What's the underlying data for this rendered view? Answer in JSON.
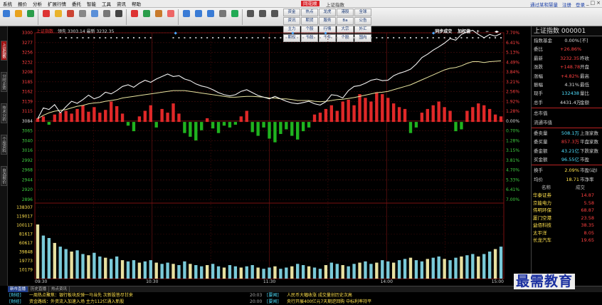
{
  "menu": [
    "系统",
    "报价",
    "分析",
    "扩展行情",
    "委托",
    "智能",
    "工具",
    "资讯",
    "帮助"
  ],
  "app_logo": "同花顺",
  "window_title": "上证指数",
  "menu_right": [
    "通过某和慧量",
    "注册",
    "登录"
  ],
  "window_controls": [
    "_",
    "□",
    "×"
  ],
  "toolbar": [
    {
      "label": "",
      "icon": "grid-icon",
      "color": "#3a7bd5"
    },
    {
      "label": "",
      "icon": "back-icon",
      "color": "#e8a21c"
    },
    {
      "label": "",
      "icon": "forward-icon",
      "color": "#2a9d4a"
    },
    {
      "label": "",
      "icon": "refresh-icon",
      "color": "#d33"
    },
    {
      "label": "",
      "icon": "star-icon",
      "color": "#e9b32c"
    },
    {
      "label": "",
      "icon": "flag-icon",
      "color": "#c43"
    },
    {
      "label": "",
      "icon": "bell-icon",
      "color": "#888"
    },
    {
      "label": "",
      "icon": "doc-icon",
      "color": "#5a8fd8"
    },
    {
      "label": "",
      "icon": "calc-icon",
      "color": "#777"
    },
    {
      "label": "",
      "icon": "news-icon",
      "color": "#444"
    },
    {
      "label": "",
      "icon": "buy-icon",
      "color": "#d33"
    },
    {
      "label": "",
      "icon": "sell-icon",
      "color": "#2a9d4a"
    },
    {
      "label": "",
      "icon": "lock-icon",
      "color": "#c87a2c"
    },
    {
      "label": "",
      "icon": "cash-icon",
      "color": "#e66"
    },
    {
      "label": "",
      "icon": "chart-icon",
      "color": "#3a7bd5"
    },
    {
      "label": "",
      "icon": "chart2-icon",
      "color": "#3a7bd5"
    },
    {
      "label": "",
      "icon": "kline-icon",
      "color": "#3a7bd5"
    },
    {
      "label": "",
      "icon": "pen-icon",
      "color": "#777"
    },
    {
      "label": "",
      "icon": "f10-icon",
      "color": "#2a5"
    },
    {
      "label": "",
      "icon": "zoom-icon",
      "color": "#555"
    },
    {
      "label": "",
      "icon": "info-icon",
      "color": "#555"
    },
    {
      "label": "",
      "icon": "list-icon",
      "color": "#555"
    }
  ],
  "toolbar_group": [
    "资金",
    "热点",
    "龙虎",
    "港股",
    "全球",
    "资讯",
    "期货",
    "服务",
    "Ba",
    "公告",
    "主力",
    "个股",
    "行情",
    "大宗",
    "外汇",
    "期权",
    "千股",
    "千牛",
    "个股",
    "国内",
    "指数",
    "财务",
    "资金",
    "价值",
    "研报",
    "行情",
    "综合",
    "经济"
  ],
  "left_tabs": [
    {
      "label": "上证指数",
      "active": true
    },
    {
      "label": "分时走势",
      "active": false
    },
    {
      "label": "技术分析",
      "active": false
    },
    {
      "label": "个股资料",
      "active": false
    },
    {
      "label": "自选报价",
      "active": false
    }
  ],
  "chart_header": {
    "code_name": "上证指数",
    "line1": "领先 3303.14 最新 3232.35",
    "right_label": "同步成交",
    "right_label2": "加权值"
  },
  "chart_data": {
    "type": "line",
    "base": 3084,
    "y_labels_left": [
      "3300",
      "3277",
      "3256",
      "3232",
      "3208",
      "3185",
      "3162",
      "3139",
      "3115",
      "3084",
      "3065",
      "3040",
      "3016",
      "2992",
      "2968",
      "2944",
      "2920",
      "2896"
    ],
    "y_labels_right": [
      "7.70%",
      "6.41%",
      "5.13%",
      "4.49%",
      "3.84%",
      "3.21%",
      "2.56%",
      "1.92%",
      "1.28%",
      "0.00%",
      "0.70%",
      "1.28%",
      "3.15%",
      "3.81%",
      "4.70%",
      "5.33%",
      "6.41%",
      "7.00%"
    ],
    "vol_labels": [
      "138307",
      "119017",
      "100117",
      "81617",
      "60617",
      "39848",
      "19773",
      "10179"
    ],
    "time_labels": [
      "09:30",
      "10:30",
      "11:30",
      "14:00",
      "15:00"
    ],
    "ylim": [
      2896,
      3300
    ],
    "price": [
      3092,
      3118,
      3114,
      3126,
      3106,
      3121,
      3134,
      3129,
      3138,
      3149,
      3140,
      3145,
      3156,
      3152,
      3160,
      3170,
      3174,
      3168,
      3178,
      3185,
      3180,
      3188,
      3194,
      3200,
      3194,
      3196,
      3188,
      3184,
      3176,
      3171,
      3168,
      3162,
      3155,
      3150,
      3147,
      3150,
      3158,
      3162,
      3155,
      3148,
      3144,
      3140,
      3146,
      3140,
      3134,
      3130,
      3128,
      3131,
      3134,
      3128,
      3125,
      3133,
      3150,
      3148,
      3142,
      3160,
      3170,
      3172,
      3178,
      3185,
      3188,
      3184,
      3185,
      3196,
      3202,
      3206,
      3212,
      3224,
      3240,
      3248,
      3258,
      3266,
      3275,
      3286,
      3282,
      3296,
      3302,
      3306,
      3296,
      3288,
      3296,
      3292,
      3298
    ],
    "avg": [
      3092,
      3100,
      3106,
      3110,
      3112,
      3114,
      3118,
      3122,
      3124,
      3128,
      3130,
      3131,
      3134,
      3136,
      3138,
      3142,
      3144,
      3146,
      3148,
      3150,
      3152,
      3154,
      3156,
      3158,
      3160,
      3160,
      3160,
      3158,
      3156,
      3154,
      3152,
      3150,
      3148,
      3146,
      3144,
      3144,
      3145,
      3146,
      3146,
      3145,
      3144,
      3142,
      3142,
      3140,
      3140,
      3138,
      3136,
      3136,
      3136,
      3134,
      3133,
      3134,
      3136,
      3138,
      3139,
      3141,
      3143,
      3146,
      3149,
      3152,
      3155,
      3156,
      3158,
      3162,
      3166,
      3170,
      3174,
      3180,
      3186,
      3192,
      3198,
      3204,
      3210,
      3214,
      3216,
      3220,
      3226,
      3230,
      3230,
      3228,
      3230,
      3231,
      3232
    ],
    "flow": [
      4,
      6,
      -3,
      8,
      10,
      12,
      9,
      14,
      18,
      11,
      16,
      10,
      13,
      22,
      17,
      9,
      -4,
      -10,
      6,
      12,
      18,
      -6,
      14,
      10,
      20,
      9,
      -12,
      -16,
      -20,
      -9,
      4,
      -7,
      -12,
      -4,
      -6,
      -3,
      6,
      12,
      -11,
      -15,
      -6,
      -18,
      -22,
      -13,
      -8,
      -15,
      -19,
      -10,
      -6,
      8,
      10,
      14,
      18,
      12,
      22,
      24,
      18,
      30,
      26,
      22,
      32,
      30,
      26,
      20,
      16,
      14,
      -12,
      -6,
      10,
      14,
      18,
      22,
      16,
      12,
      -10,
      -8,
      12,
      16,
      20,
      18,
      14,
      8,
      6
    ],
    "volume": [
      88,
      70,
      66,
      58,
      52,
      48,
      44,
      46,
      40,
      38,
      42,
      36,
      34,
      32,
      36,
      30,
      28,
      30,
      26,
      28,
      30,
      26,
      24,
      26,
      24,
      22,
      28,
      24,
      22,
      20,
      22,
      24,
      20,
      18,
      22,
      20,
      18,
      20,
      22,
      18,
      16,
      18,
      20,
      16,
      18,
      20,
      24,
      22,
      20,
      18,
      16,
      22,
      26,
      24,
      22,
      20,
      24,
      26,
      28,
      24,
      26,
      30,
      28,
      26,
      30,
      32,
      34,
      30,
      28,
      32,
      34,
      36,
      32,
      30,
      34,
      36,
      38,
      40,
      36,
      40,
      44,
      48,
      52
    ]
  },
  "right_panel": {
    "title": "上证指数 000001",
    "rows": [
      {
        "k": "指数基金",
        "v": "0.00%",
        "k2": "[不]",
        "vc": "w"
      },
      {
        "k": "委比",
        "v": "+26.86%",
        "k2": "",
        "vc": "r"
      },
      {
        "k": "最新",
        "v": "3232.35",
        "k2": "昨收",
        "vc": "r"
      },
      {
        "k": "涨跌",
        "v": "+148.78",
        "k2": "开盘",
        "vc": "r"
      },
      {
        "k": "涨幅",
        "v": "+4.82%",
        "k2": "最高",
        "vc": "r"
      },
      {
        "k": "振幅",
        "v": "4.31%",
        "k2": "最低",
        "vc": "w"
      },
      {
        "k": "现手",
        "v": "132438",
        "k2": "量比",
        "vc": "c"
      },
      {
        "k": "总手",
        "v": "4431.4万",
        "k2": "金额",
        "vc": "w"
      },
      {
        "k": "总市值",
        "v": "",
        "k2": "",
        "vc": "w"
      },
      {
        "k": "流通市值",
        "v": "",
        "k2": "",
        "vc": "w"
      },
      {
        "k": "委卖量",
        "v": "508.1万",
        "k2": "上涨家数",
        "vc": "c"
      },
      {
        "k": "委买量",
        "v": "857.3万",
        "k2": "平盘家数",
        "vc": "r"
      },
      {
        "k": "委金额",
        "v": "43.21亿",
        "k2": "下跌家数",
        "vc": "c"
      },
      {
        "k": "买金额",
        "v": "96.55亿",
        "k2": "市盈",
        "vc": "c"
      },
      {
        "k": "换手",
        "v": "2.09%",
        "k2": "市盈(动)",
        "vc": "y"
      },
      {
        "k": "均价",
        "v": "18.71",
        "k2": "市净率",
        "vc": "y"
      }
    ],
    "stock_head": {
      "name": "名称",
      "value": "成交"
    },
    "stocks": [
      {
        "name": "华泰证券",
        "value": "14.87"
      },
      {
        "name": "京能电力",
        "value": "5.58"
      },
      {
        "name": "伟明环保",
        "value": "68.87"
      },
      {
        "name": "厦门空港",
        "value": "23.58"
      },
      {
        "name": "益佰科技",
        "value": "38.35"
      },
      {
        "name": "太平洋",
        "value": "8.05"
      },
      {
        "name": "长龙汽车",
        "value": "19.65"
      }
    ]
  },
  "bottom": {
    "tabs": [
      {
        "label": "新市直播",
        "active": true
      },
      {
        "label": "历史直播",
        "active": false
      },
      {
        "label": "热点资讯",
        "active": false
      }
    ],
    "news": [
      {
        "badge": "[财经]",
        "text": "一周热点聚焦：银行板块反弹一马当先 次新股答尽甘来",
        "time": "20:03",
        "badge2": "[要闻]",
        "text2": "人民币大幅收涨 成交量创历史次高"
      },
      {
        "badge": "[财经]",
        "text": "资金路线：外资流入加速入场 主力112亿涌入新股",
        "time": "20:00",
        "badge2": "[要闻]",
        "text2": "央行开展400亿元7天期逆回购 中标利率持平"
      }
    ]
  },
  "watermark": "最需教育"
}
